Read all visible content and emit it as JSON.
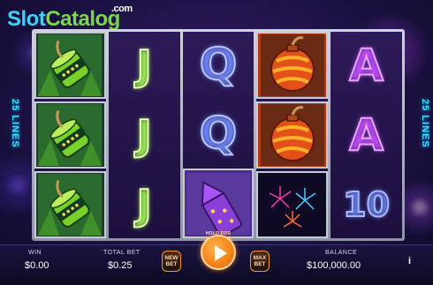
{
  "watermark": {
    "slot": "Slot",
    "catalog": "Catalog",
    "dotcom": ".com"
  },
  "side_label": "25 LINES",
  "reels": [
    [
      "firecracker-green",
      "firecracker-green",
      "firecracker-green"
    ],
    [
      "J",
      "J",
      "J"
    ],
    [
      "Q",
      "Q",
      "rocket-purple"
    ],
    [
      "bomb-orange",
      "bomb-orange",
      "fireworks-burst"
    ],
    [
      "A",
      "A",
      "10"
    ]
  ],
  "bottom_bar": {
    "win_label": "WIN",
    "win_value": "$0.00",
    "total_bet_label": "TOTAL BET",
    "total_bet_value": "$0.25",
    "new_bet_label": "NEW BET",
    "hold_for_autospin": "HOLD FOR AUTOSPIN",
    "max_bet_label": "MAX BET",
    "balance_label": "BALANCE",
    "balance_value": "$100,000.00",
    "info_label": "i"
  },
  "colors": {
    "accent_orange": "#f07a10",
    "lines_cyan": "#3fe0ff",
    "bg_purple": "#1d1245"
  }
}
